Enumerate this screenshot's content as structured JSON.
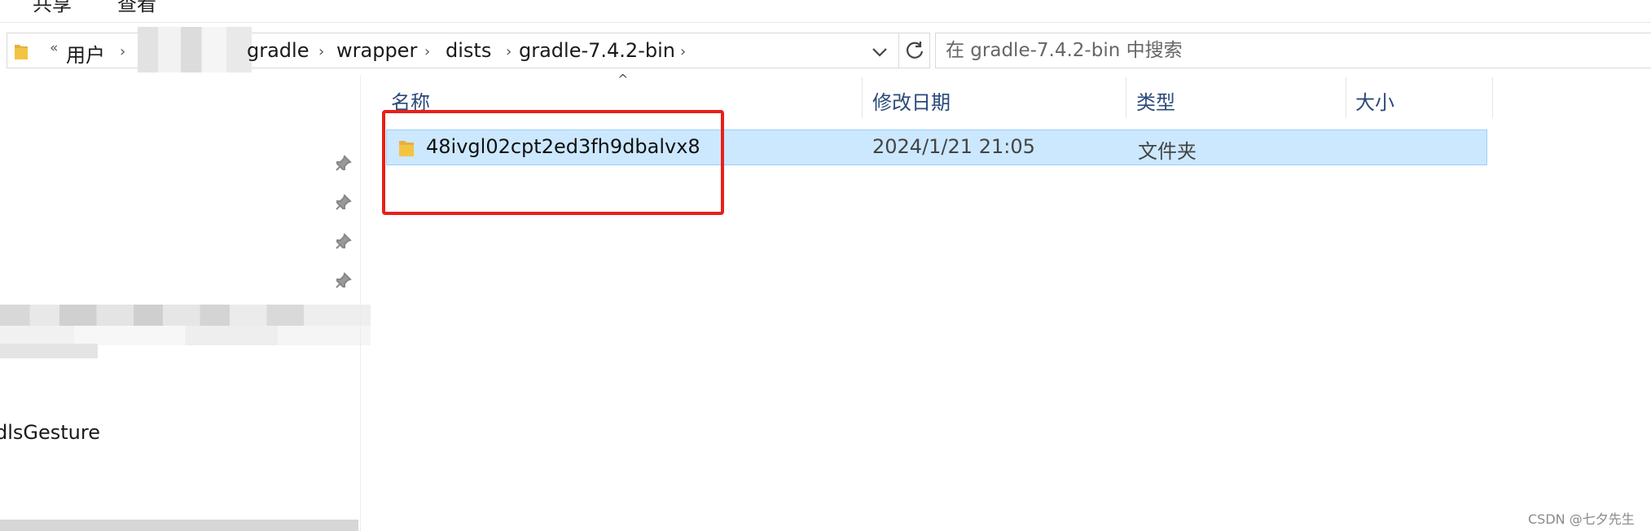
{
  "ribbon": {
    "tabs": [
      "共享",
      "查看"
    ]
  },
  "address_bar": {
    "more_label": "«",
    "crumbs": [
      "用户",
      "gradle",
      "wrapper",
      "dists",
      "gradle-7.4.2-bin"
    ],
    "separator": "›",
    "dropdown_glyph": "⌄",
    "refresh_glyph": "↻"
  },
  "search": {
    "placeholder": "在 gradle-7.4.2-bin 中搜索"
  },
  "nav_pane": {
    "partial_item_label": "dlsGesture"
  },
  "file_list": {
    "sort_glyph": "^",
    "columns": [
      "名称",
      "修改日期",
      "类型",
      "大小"
    ],
    "rows": [
      {
        "name": "48ivgl02cpt2ed3fh9dbalvx8",
        "modified": "2024/1/21 21:05",
        "type": "文件夹",
        "size": ""
      }
    ]
  },
  "watermark": "CSDN @七夕先生",
  "colors": {
    "selection_bg": "#cce8ff",
    "highlight_box": "#e8201a",
    "folder_yellow": "#f3c442"
  }
}
